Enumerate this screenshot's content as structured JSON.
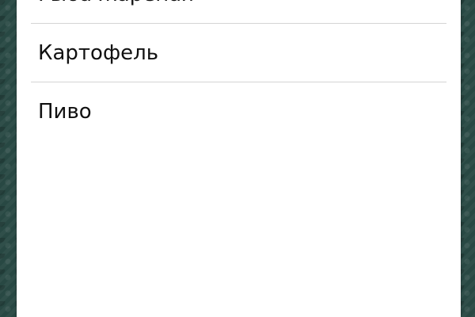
{
  "list": {
    "items": [
      {
        "label": "Рыба жареная"
      },
      {
        "label": "Картофель"
      },
      {
        "label": "Пиво"
      }
    ]
  }
}
